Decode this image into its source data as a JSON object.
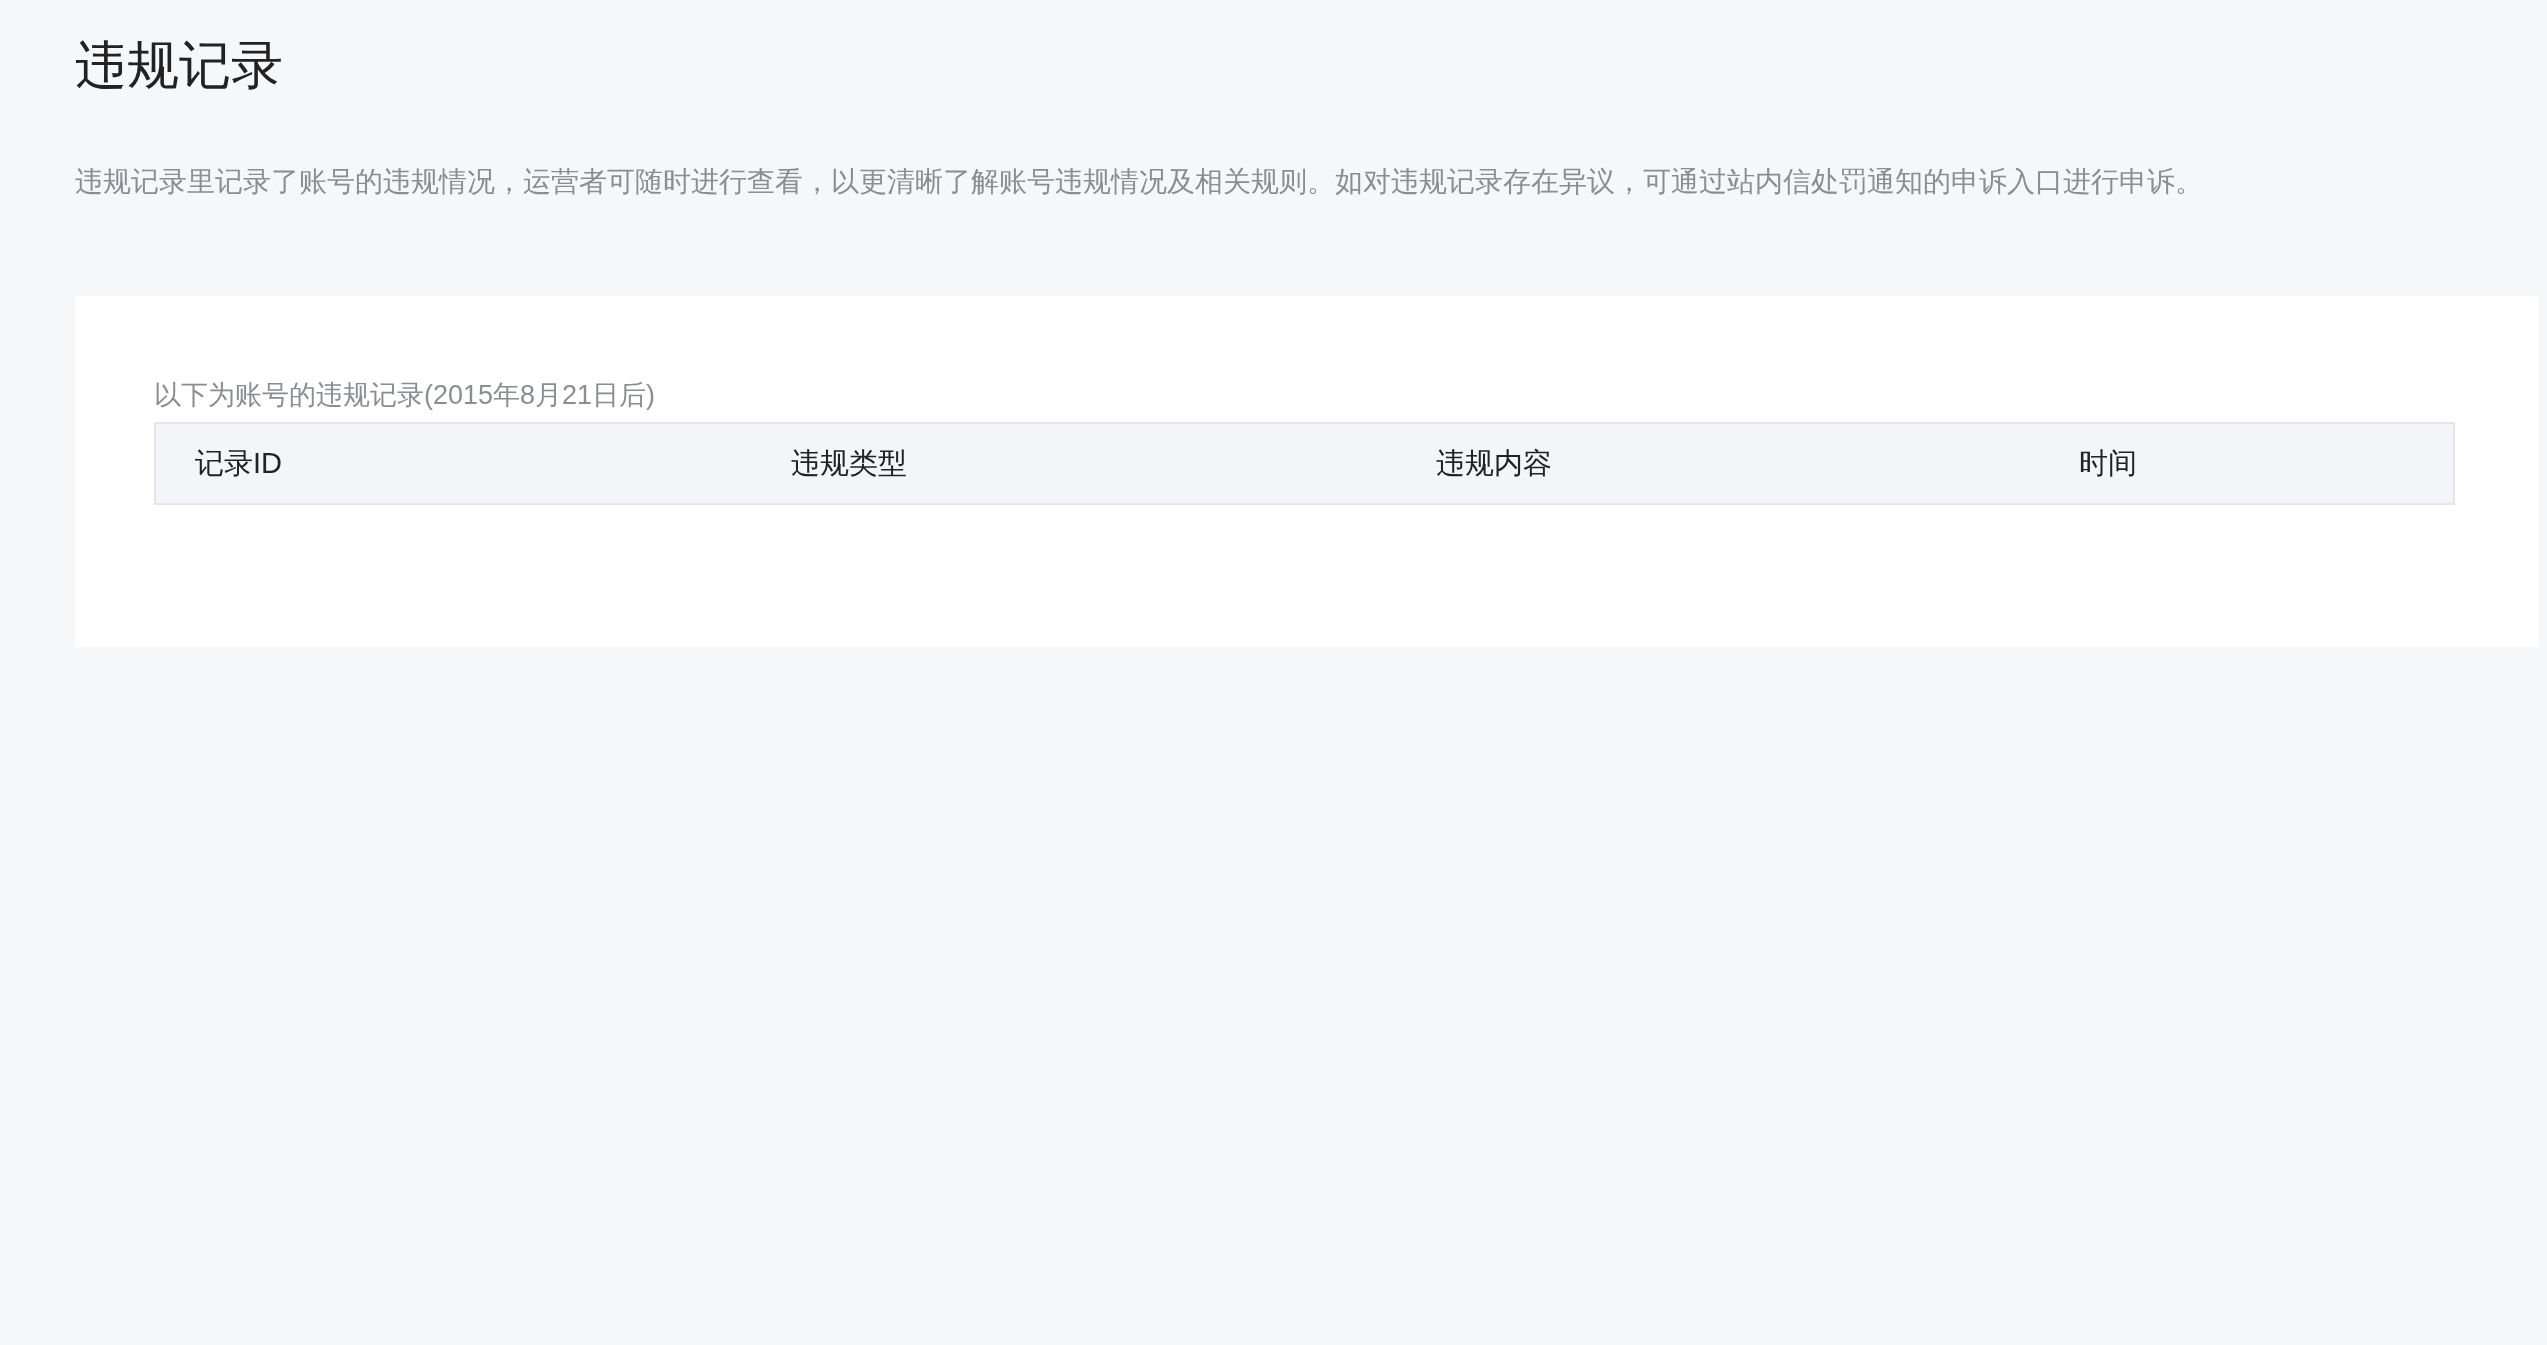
{
  "page": {
    "title": "违规记录",
    "description": "违规记录里记录了账号的违规情况，运营者可随时进行查看，以更清晰了解账号违规情况及相关规则。如对违规记录存在异议，可通过站内信处罚通知的申诉入口进行申诉。"
  },
  "card": {
    "caption": "以下为账号的违规记录(2015年8月21日后)",
    "table": {
      "columns": [
        "记录ID",
        "违规类型",
        "违规内容",
        "时间"
      ]
    }
  }
}
